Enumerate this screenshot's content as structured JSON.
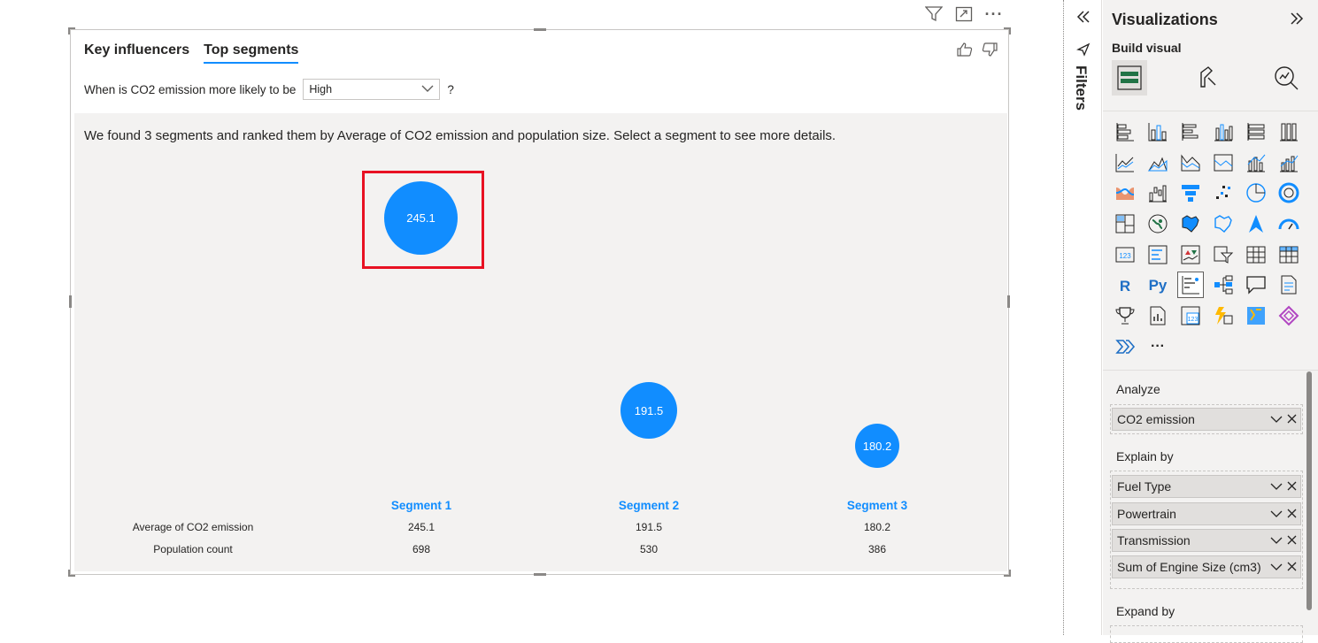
{
  "visual_header": {
    "icons": [
      "filter-icon",
      "focus-mode-icon",
      "more-options-icon"
    ],
    "more_label": "···"
  },
  "tabs": [
    {
      "label": "Key influencers",
      "active": false
    },
    {
      "label": "Top segments",
      "active": true
    }
  ],
  "question": {
    "prefix": "When is CO2 emission more likely to be",
    "selected": "High",
    "suffix": "?"
  },
  "summary": "We found 3 segments and ranked them by Average of CO2 emission and population size. Select a segment to see more details.",
  "segments": [
    {
      "label": "Segment 1",
      "bubble": "245.1",
      "avg": "245.1",
      "count": "698"
    },
    {
      "label": "Segment 2",
      "bubble": "191.5",
      "avg": "191.5",
      "count": "530"
    },
    {
      "label": "Segment 3",
      "bubble": "180.2",
      "avg": "180.2",
      "count": "386"
    }
  ],
  "row_labels": {
    "avg": "Average of CO2 emission",
    "count": "Population count"
  },
  "filters_pane": {
    "label": "Filters"
  },
  "viz_pane": {
    "title": "Visualizations",
    "build_visual": "Build visual",
    "more_visuals": "···",
    "analyze_label": "Analyze",
    "analyze_field": "CO2 emission",
    "explain_label": "Explain by",
    "explain_fields": [
      "Fuel Type",
      "Powertrain",
      "Transmission",
      "Sum of Engine Size (cm3)"
    ],
    "expand_label": "Expand by"
  },
  "colors": {
    "accent": "#118dff",
    "highlight": "#e81123"
  }
}
